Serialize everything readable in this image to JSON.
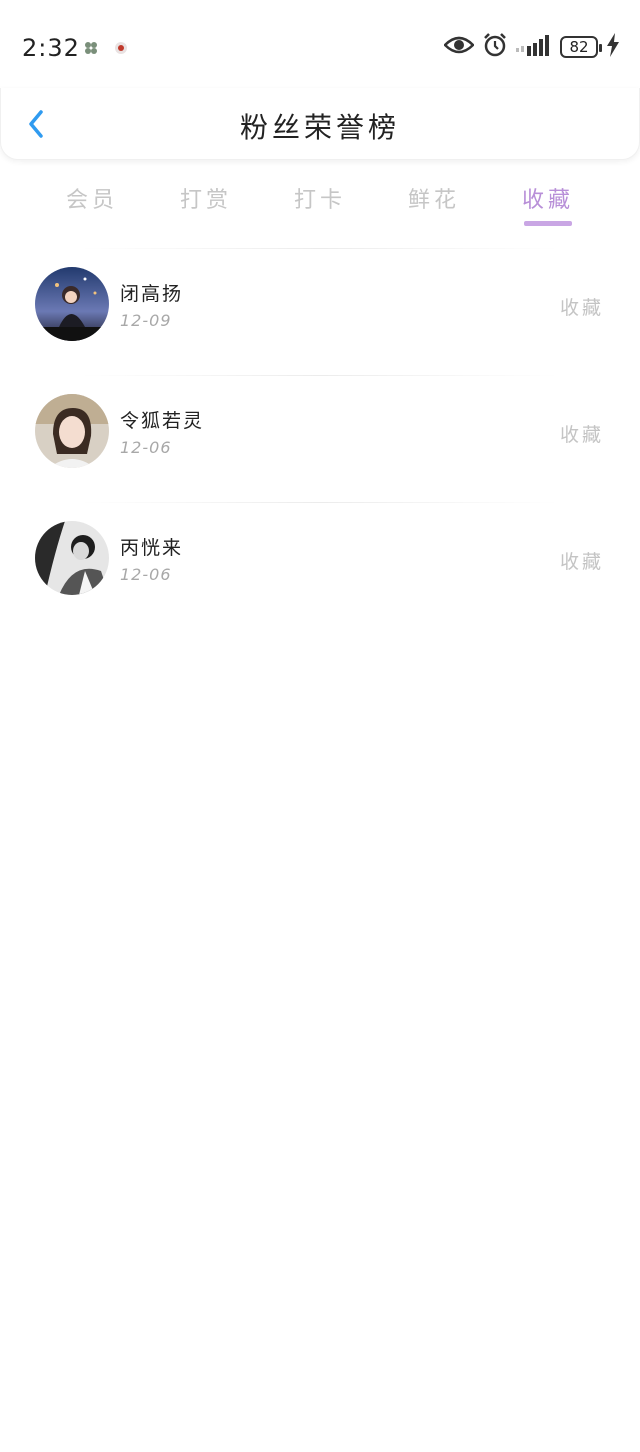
{
  "status_bar": {
    "time": "2:32",
    "battery": "82",
    "icons": [
      "clover-icon",
      "notification-app-icon",
      "eye-icon",
      "alarm-icon",
      "signal-icon",
      "battery-icon",
      "charging-icon"
    ]
  },
  "header": {
    "title": "粉丝荣誉榜",
    "back_icon": "chevron-left-icon",
    "accent_color": "#2f9bf0"
  },
  "tabs": [
    {
      "label": "会员",
      "active": false
    },
    {
      "label": "打赏",
      "active": false
    },
    {
      "label": "打卡",
      "active": false
    },
    {
      "label": "鲜花",
      "active": false
    },
    {
      "label": "收藏",
      "active": true
    }
  ],
  "active_tab_color": "#b88fd8",
  "fans": [
    {
      "name": "闭高扬",
      "date": "12-09",
      "action": "收藏",
      "avatar": "anime-girl-night-avatar"
    },
    {
      "name": "令狐若灵",
      "date": "12-06",
      "action": "收藏",
      "avatar": "woman-photo-avatar"
    },
    {
      "name": "丙恍来",
      "date": "12-06",
      "action": "收藏",
      "avatar": "monochrome-couple-avatar"
    }
  ]
}
